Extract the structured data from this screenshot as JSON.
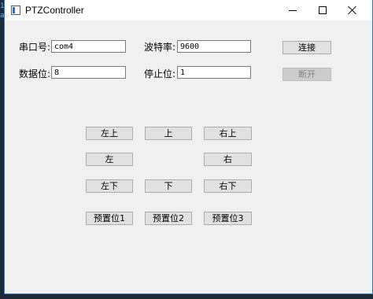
{
  "window": {
    "title": "PTZController",
    "icon": "app-window-icon"
  },
  "serial": {
    "port_label": "串口号:",
    "port_value": "com4",
    "baud_label": "波特率:",
    "baud_value": "9600",
    "databits_label": "数据位:",
    "databits_value": "8",
    "stopbits_label": "停止位:",
    "stopbits_value": "1",
    "connect_label": "连接",
    "disconnect_label": "断开"
  },
  "ptz": {
    "up_left": "左上",
    "up": "上",
    "up_right": "右上",
    "left": "左",
    "right": "右",
    "down_left": "左下",
    "down": "下",
    "down_right": "右下",
    "preset1": "预置位1",
    "preset2": "预置位2",
    "preset3": "预置位3"
  },
  "colors": {
    "window_bg": "#f0f0f0",
    "button_bg": "#e1e1e1",
    "disabled_text": "#838383",
    "border_accent": "#2b78d4"
  }
}
